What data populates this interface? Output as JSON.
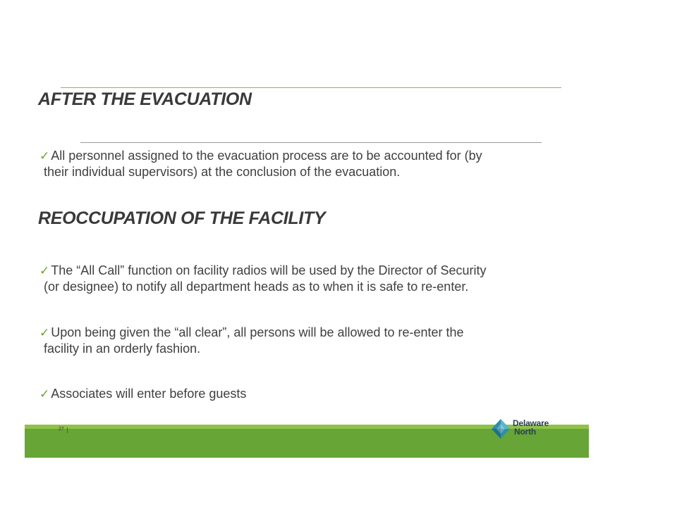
{
  "slide": {
    "heading1": "AFTER THE EVACUATION",
    "heading2": "REOCCUPATION OF THE FACILITY",
    "check_glyph": "✓",
    "bullets": [
      {
        "line1": "All personnel assigned to the evacuation process are to be accounted for (by",
        "line2": "their individual supervisors) at the conclusion of the evacuation."
      },
      {
        "line1": "The “All Call” function on facility radios will be used by the Director of Security",
        "line2": "(or designee) to notify all department heads as to when it is safe to re-enter."
      },
      {
        "line1": "Upon being given the “all clear”, all persons will be allowed to re-enter the",
        "line2": "facility in an orderly fashion."
      },
      {
        "line1": "Associates will enter before guests"
      }
    ]
  },
  "footer": {
    "page_number": "27",
    "logo_line1": "Delaware",
    "logo_line2": "North",
    "logo_icon": "delaware-north-diamond-logo",
    "colors": {
      "bar": "#66a536",
      "stripe": "#8fc249",
      "accent_line": "#8db84a",
      "check": "#6aa230"
    }
  }
}
